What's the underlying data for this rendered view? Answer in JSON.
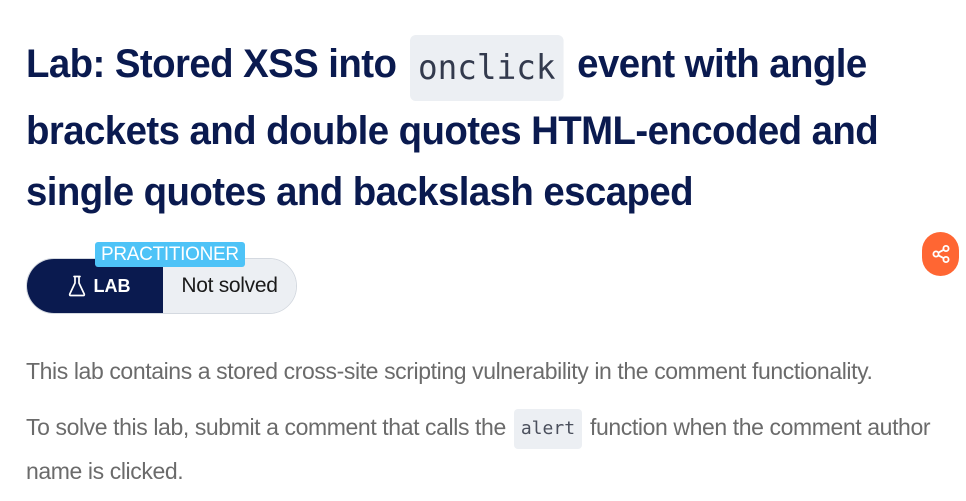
{
  "lab": {
    "title_before": "Lab: Stored XSS into",
    "title_code": "onclick",
    "title_after": "event with angle brackets and double quotes HTML-encoded and single quotes and backslash escaped",
    "level": "PRACTITIONER",
    "type_label": "LAB",
    "type_icon": "flask-icon",
    "status": "Not solved"
  },
  "share": {
    "icon": "share-icon",
    "color": "#ff6633"
  },
  "description": {
    "paragraph1": "This lab contains a stored cross-site scripting vulnerability in the comment functionality.",
    "paragraph2_before": "To solve this lab, submit a comment that calls the",
    "paragraph2_code": "alert",
    "paragraph2_after": "function when the comment author name is clicked."
  },
  "colors": {
    "title": "#0a1a4f",
    "pill_dark": "#0a1a4f",
    "level_tag": "#4ec3f7",
    "code_bg": "#eceff3",
    "body_text": "#6b6b6b"
  }
}
